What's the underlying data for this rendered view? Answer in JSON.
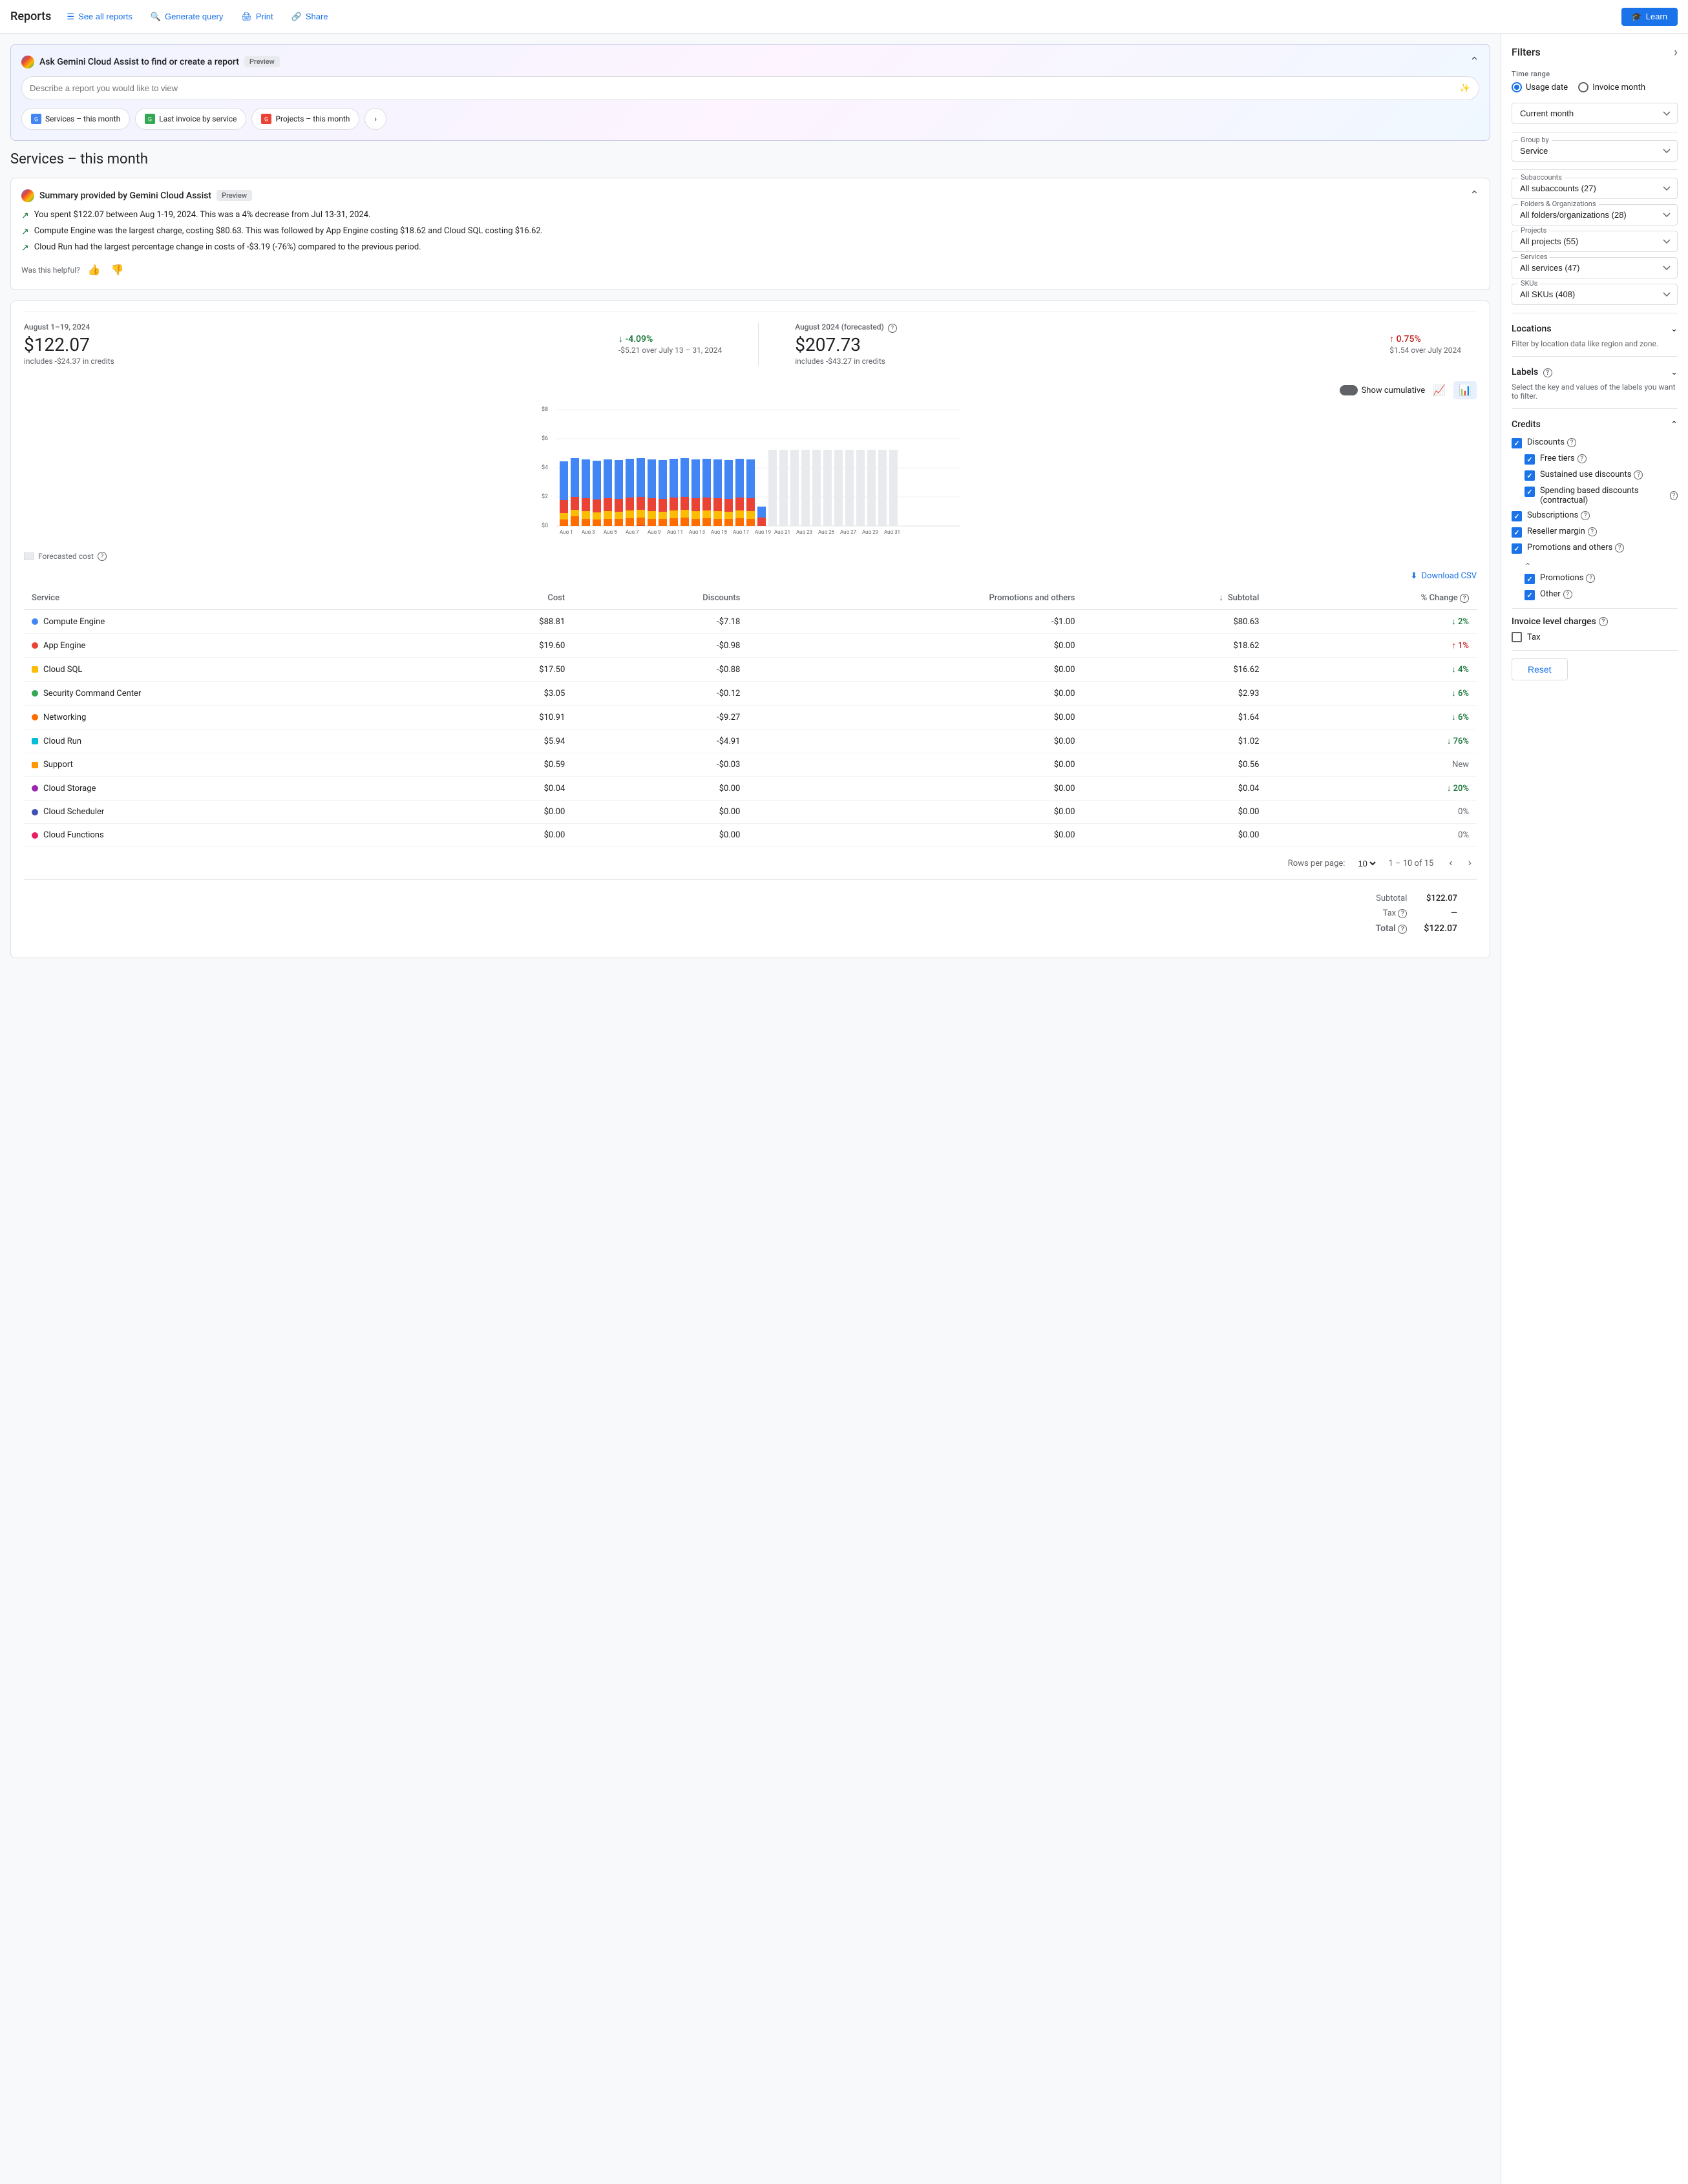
{
  "nav": {
    "title": "Reports",
    "see_all": "See all reports",
    "generate_query": "Generate query",
    "print": "Print",
    "share": "Share",
    "learn": "Learn"
  },
  "gemini": {
    "title": "Ask Gemini Cloud Assist to find or create a report",
    "badge": "Preview",
    "placeholder": "Describe a report you would like to view",
    "chips": [
      "Services – this month",
      "Last invoice by service",
      "Projects – this month"
    ]
  },
  "page_title": "Services – this month",
  "summary": {
    "title": "Summary provided by Gemini Cloud Assist",
    "badge": "Preview",
    "lines": [
      "You spent $122.07 between Aug 1-19, 2024. This was a 4% decrease from Jul 13-31, 2024.",
      "Compute Engine was the largest charge, costing $80.63. This was followed by App Engine costing $18.62 and Cloud SQL costing $16.62.",
      "Cloud Run had the largest percentage change in costs of -$3.19 (-76%) compared to the previous period."
    ],
    "feedback_label": "Was this helpful?"
  },
  "current_period": {
    "label": "August 1–19, 2024",
    "amount": "$122.07",
    "sub": "includes -$24.37 in credits",
    "change": "↓ -4.09%",
    "change_type": "down",
    "change_sub": "-$5.21 over July 13 – 31, 2024"
  },
  "forecast_period": {
    "label": "August 2024 (forecasted)",
    "amount": "$207.73",
    "sub": "includes -$43.27 in credits",
    "change": "↑ 0.75%",
    "change_type": "up",
    "change_sub": "$1.54 over July 2024"
  },
  "chart": {
    "show_cumulative": "Show cumulative",
    "y_max": "$8",
    "y_labels": [
      "$8",
      "$6",
      "$4",
      "$2",
      "$0"
    ],
    "x_labels": [
      "Aug 1",
      "Aug 3",
      "Aug 5",
      "Aug 7",
      "Aug 9",
      "Aug 11",
      "Aug 13",
      "Aug 15",
      "Aug 17",
      "Aug 19",
      "Aug 21",
      "Aug 23",
      "Aug 25",
      "Aug 27",
      "Aug 29",
      "Aug 31"
    ],
    "forecasted_legend": "Forecasted cost"
  },
  "table": {
    "download_csv": "Download CSV",
    "columns": [
      "Service",
      "Cost",
      "Discounts",
      "Promotions and others",
      "Subtotal",
      "% Change"
    ],
    "rows": [
      {
        "service": "Compute Engine",
        "dot": "compute",
        "cost": "$88.81",
        "discounts": "-$7.18",
        "promotions": "-$1.00",
        "subtotal": "$80.63",
        "change": "↓ 2%",
        "change_type": "down"
      },
      {
        "service": "App Engine",
        "dot": "appengine",
        "cost": "$19.60",
        "discounts": "-$0.98",
        "promotions": "$0.00",
        "subtotal": "$18.62",
        "change": "↑ 1%",
        "change_type": "up"
      },
      {
        "service": "Cloud SQL",
        "dot": "sql",
        "cost": "$17.50",
        "discounts": "-$0.88",
        "promotions": "$0.00",
        "subtotal": "$16.62",
        "change": "↓ 4%",
        "change_type": "down"
      },
      {
        "service": "Security Command Center",
        "dot": "security",
        "cost": "$3.05",
        "discounts": "-$0.12",
        "promotions": "$0.00",
        "subtotal": "$2.93",
        "change": "↓ 6%",
        "change_type": "down"
      },
      {
        "service": "Networking",
        "dot": "networking",
        "cost": "$10.91",
        "discounts": "-$9.27",
        "promotions": "$0.00",
        "subtotal": "$1.64",
        "change": "↓ 6%",
        "change_type": "down"
      },
      {
        "service": "Cloud Run",
        "dot": "cloudrun",
        "cost": "$5.94",
        "discounts": "-$4.91",
        "promotions": "$0.00",
        "subtotal": "$1.02",
        "change": "↓ 76%",
        "change_type": "down_large"
      },
      {
        "service": "Support",
        "dot": "support",
        "cost": "$0.59",
        "discounts": "-$0.03",
        "promotions": "$0.00",
        "subtotal": "$0.56",
        "change": "New",
        "change_type": "neutral"
      },
      {
        "service": "Cloud Storage",
        "dot": "storage",
        "cost": "$0.04",
        "discounts": "$0.00",
        "promotions": "$0.00",
        "subtotal": "$0.04",
        "change": "↓ 20%",
        "change_type": "down"
      },
      {
        "service": "Cloud Scheduler",
        "dot": "scheduler",
        "cost": "$0.00",
        "discounts": "$0.00",
        "promotions": "$0.00",
        "subtotal": "$0.00",
        "change": "0%",
        "change_type": "neutral"
      },
      {
        "service": "Cloud Functions",
        "dot": "functions",
        "cost": "$0.00",
        "discounts": "$0.00",
        "promotions": "$0.00",
        "subtotal": "$0.00",
        "change": "0%",
        "change_type": "neutral"
      }
    ],
    "pagination": {
      "rows_per_page": "Rows per page:",
      "per_page": "10",
      "range": "1 – 10 of 15"
    },
    "totals": {
      "subtotal_label": "Subtotal",
      "subtotal_value": "$122.07",
      "tax_label": "Tax",
      "tax_help": true,
      "tax_value": "—",
      "total_label": "Total",
      "total_help": true,
      "total_value": "$122.07"
    }
  },
  "filters": {
    "title": "Filters",
    "time_range": {
      "label": "Time range",
      "option1": "Usage date",
      "option2": "Invoice month"
    },
    "current_month": "Current month",
    "group_by": {
      "label": "Group by",
      "value": "Service"
    },
    "subaccounts": {
      "label": "Subaccounts",
      "value": "All subaccounts (27)"
    },
    "folders": {
      "label": "Folders & Organizations",
      "value": "All folders/organizations (28)"
    },
    "projects": {
      "label": "Projects",
      "value": "All projects (55)"
    },
    "services": {
      "label": "Services",
      "value": "All services (47)"
    },
    "skus": {
      "label": "SKUs",
      "value": "All SKUs (408)"
    },
    "locations": {
      "label": "Locations",
      "sub": "Filter by location data like region and zone."
    },
    "labels": {
      "label": "Labels",
      "sub": "Select the key and values of the labels you want to filter."
    },
    "credits": {
      "label": "Credits",
      "discounts": {
        "label": "Discounts",
        "checked": true,
        "children": [
          {
            "label": "Free tiers",
            "checked": true
          },
          {
            "label": "Sustained use discounts",
            "checked": true
          },
          {
            "label": "Spending based discounts (contractual)",
            "checked": true
          }
        ]
      },
      "subscriptions": {
        "label": "Subscriptions",
        "checked": true
      },
      "reseller": {
        "label": "Reseller margin",
        "checked": true
      },
      "promotions": {
        "label": "Promotions and others",
        "checked": true,
        "children": [
          {
            "label": "Promotions",
            "checked": true
          },
          {
            "label": "Other",
            "checked": true
          }
        ]
      }
    },
    "invoice_charges": {
      "label": "Invoice level charges",
      "tax": {
        "label": "Tax",
        "checked": false
      }
    },
    "reset_label": "Reset"
  }
}
